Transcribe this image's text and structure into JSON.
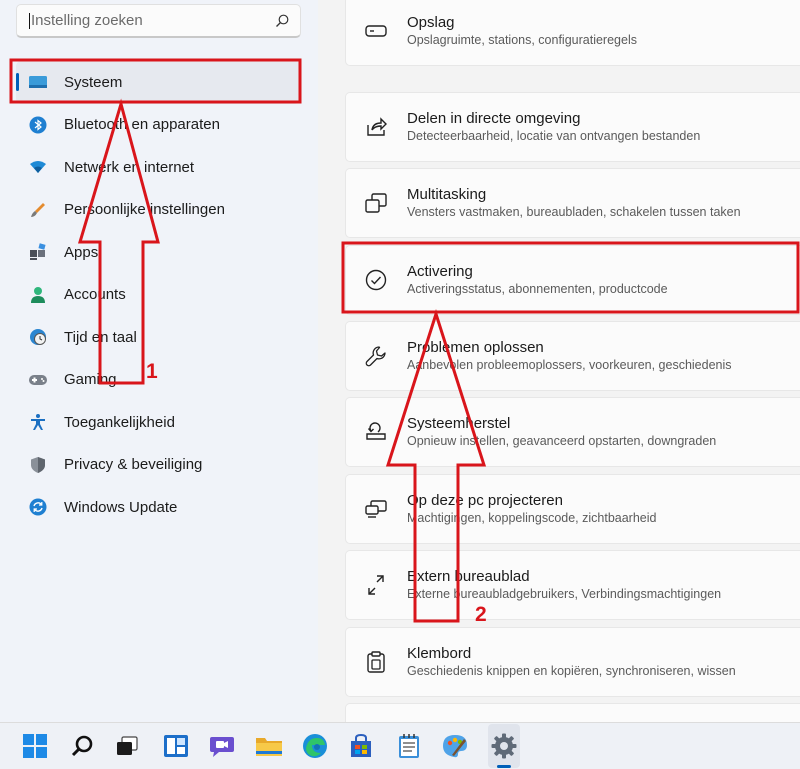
{
  "search": {
    "placeholder": "Instelling zoeken"
  },
  "sidebar": {
    "items": [
      {
        "label": "Systeem",
        "icon": "monitor-icon",
        "active": true
      },
      {
        "label": "Bluetooth en apparaten",
        "icon": "bluetooth-icon"
      },
      {
        "label": "Netwerk en internet",
        "icon": "wifi-icon"
      },
      {
        "label": "Persoonlijke instellingen",
        "icon": "brush-icon"
      },
      {
        "label": "Apps",
        "icon": "apps-icon"
      },
      {
        "label": "Accounts",
        "icon": "person-icon"
      },
      {
        "label": "Tijd en taal",
        "icon": "clock-globe-icon"
      },
      {
        "label": "Gaming",
        "icon": "gamepad-icon"
      },
      {
        "label": "Toegankelijkheid",
        "icon": "accessibility-icon"
      },
      {
        "label": "Privacy & beveiliging",
        "icon": "shield-icon"
      },
      {
        "label": "Windows Update",
        "icon": "update-icon"
      }
    ]
  },
  "main": {
    "cards": [
      {
        "title": "Opslag",
        "subtitle": "Opslagruimte, stations, configuratieregels",
        "icon": "storage-icon"
      },
      {
        "title": "Delen in directe omgeving",
        "subtitle": "Detecteerbaarheid, locatie van ontvangen bestanden",
        "icon": "share-icon"
      },
      {
        "title": "Multitasking",
        "subtitle": "Vensters vastmaken, bureaubladen, schakelen tussen taken",
        "icon": "multitasking-icon"
      },
      {
        "title": "Activering",
        "subtitle": "Activeringsstatus, abonnementen, productcode",
        "icon": "check-circle-icon"
      },
      {
        "title": "Problemen oplossen",
        "subtitle": "Aanbevolen probleemoplossers, voorkeuren, geschiedenis",
        "icon": "wrench-icon"
      },
      {
        "title": "Systeemherstel",
        "subtitle": "Opnieuw instellen, geavanceerd opstarten, downgraden",
        "icon": "recovery-icon"
      },
      {
        "title": "Op deze pc projecteren",
        "subtitle": "Machtigingen, koppelingscode, zichtbaarheid",
        "icon": "project-icon"
      },
      {
        "title": "Extern bureaublad",
        "subtitle": "Externe bureaubladgebruikers, Verbindingsmachtigingen",
        "icon": "remote-desktop-icon"
      },
      {
        "title": "Klembord",
        "subtitle": "Geschiedenis knippen en kopiëren, synchroniseren, wissen",
        "icon": "clipboard-icon"
      }
    ]
  },
  "taskbar": {
    "icons": [
      "windows-start-icon",
      "search-icon",
      "task-view-icon",
      "widgets-icon",
      "teams-chat-icon",
      "file-explorer-icon",
      "edge-icon",
      "store-icon",
      "notepad-icon",
      "paint-icon",
      "settings-icon"
    ]
  },
  "annotations": {
    "label_1": "1",
    "label_2": "2"
  },
  "colors": {
    "accent": "#005fb8",
    "annotation": "#d9151b"
  }
}
